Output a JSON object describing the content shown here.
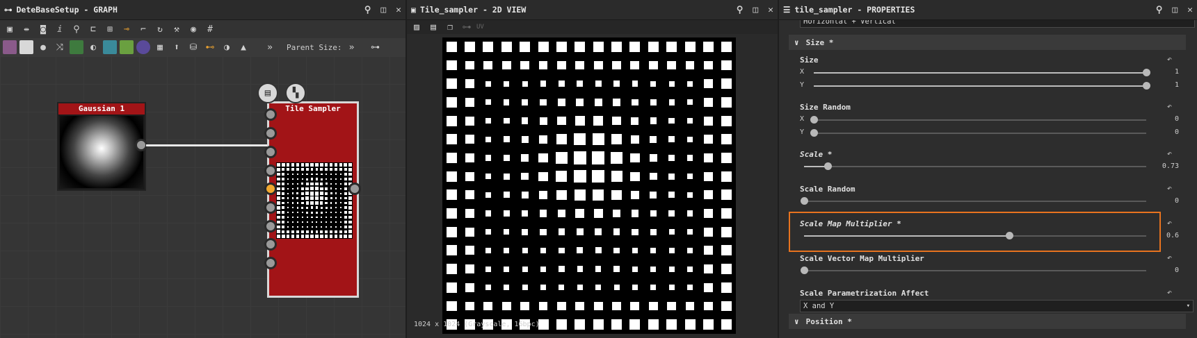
{
  "graph": {
    "title": "DeteBaseSetup - GRAPH",
    "parent_size_label": "Parent Size:",
    "nodes": {
      "gaussian": {
        "label": "Gaussian 1"
      },
      "tile_sampler": {
        "label": "Tile Sampler"
      }
    }
  },
  "view2d": {
    "title": "Tile_sampler - 2D VIEW",
    "uv_label": "UV",
    "status": "1024 x 1024 (Grayscale, 16bpc)"
  },
  "properties": {
    "title": "tile_sampler - PROPERTIES",
    "top_dropdown": "Horizontal + Vertical",
    "section_size": "Size *",
    "section_position": "Position *",
    "size": {
      "label": "Size",
      "x_axis": "X",
      "y_axis": "Y",
      "x_value": "1",
      "y_value": "1",
      "x_fraction": 1.0,
      "y_fraction": 1.0
    },
    "size_random": {
      "label": "Size Random",
      "x_axis": "X",
      "y_axis": "Y",
      "x_value": "0",
      "y_value": "0",
      "x_fraction": 0.0,
      "y_fraction": 0.0
    },
    "scale": {
      "label": "Scale *",
      "value": "0.73",
      "fraction": 0.07
    },
    "scale_random": {
      "label": "Scale Random",
      "value": "0",
      "fraction": 0.0
    },
    "scale_map_multiplier": {
      "label": "Scale Map Multiplier *",
      "value": "0.6",
      "fraction": 0.6
    },
    "scale_vector_map_multiplier": {
      "label": "Scale Vector Map Multiplier",
      "value": "0",
      "fraction": 0.0
    },
    "scale_parametrization_affect": {
      "label": "Scale Parametrization Affect",
      "value": "X and Y"
    }
  },
  "colors": {
    "node_red": "#a21417",
    "highlight": "#e8731f",
    "pin_active": "#f0a830"
  }
}
